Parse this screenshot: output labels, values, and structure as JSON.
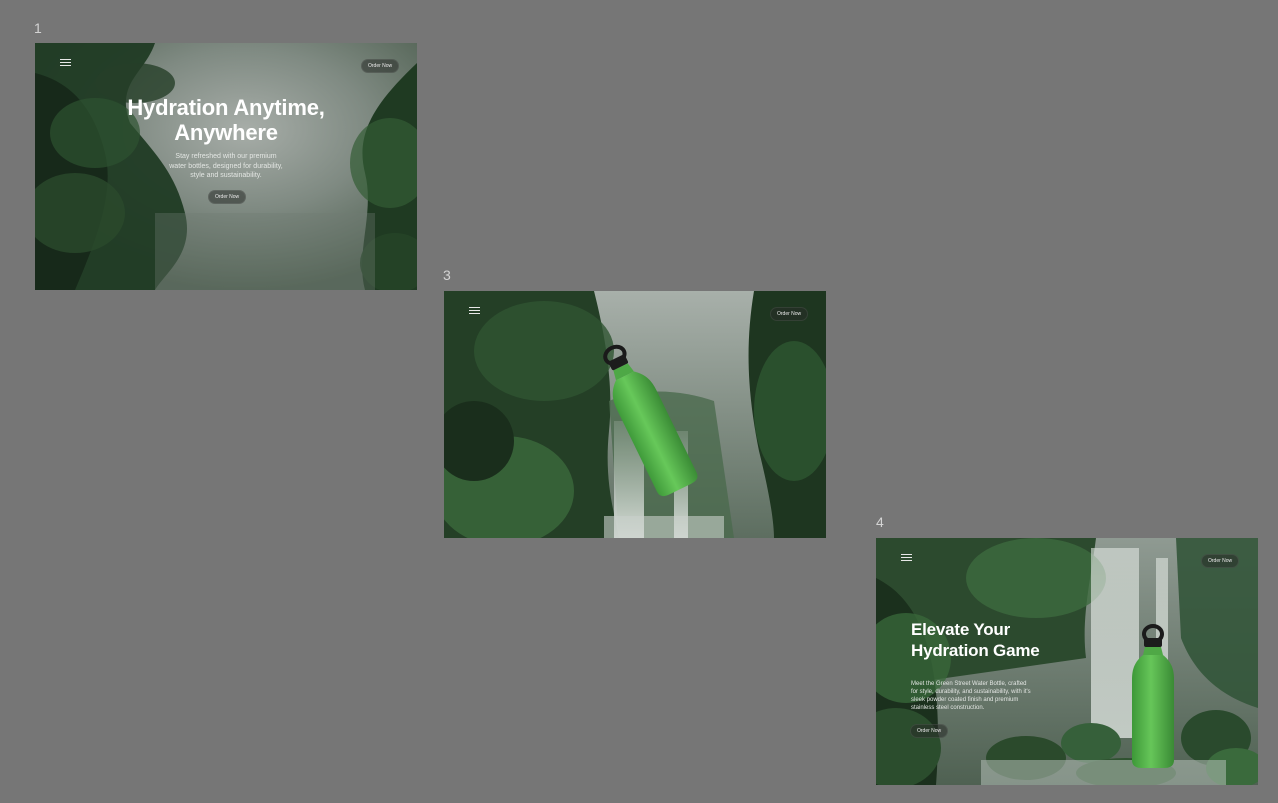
{
  "frames": [
    {
      "number": "1",
      "menu_icon": "hamburger-menu-icon",
      "order_button": "Order Now",
      "headline_line1": "Hydration Anytime,",
      "headline_line2": "Anywhere",
      "subtext_line1": "Stay refreshed with our premium",
      "subtext_line2": "water bottles, designed for durability,",
      "subtext_line3": "style and sustainability.",
      "cta_button": "Order Now"
    },
    {
      "number": "3",
      "menu_icon": "hamburger-menu-icon",
      "order_button": "Order Now",
      "product": "water-bottle-image"
    },
    {
      "number": "4",
      "menu_icon": "hamburger-menu-icon",
      "order_button": "Order Now",
      "headline_line1": "Elevate Your",
      "headline_line2": "Hydration Game",
      "body_line1": "Meet the Green Street Water Bottle, crafted",
      "body_line2": "for style, durability, and sustainability, with it's",
      "body_line3": "sleek powder coated finish and premium",
      "body_line4": "stainless steel construction.",
      "cta_button": "Order Now",
      "product": "water-bottle-image"
    }
  ],
  "colors": {
    "canvas": "#767676",
    "forest_dark": "#1d2a1f",
    "forest_mid": "#3f5a40",
    "fog": "#9aa39c",
    "bottle_green": "#5ec152",
    "bottle_cap": "#1b1b1b"
  }
}
